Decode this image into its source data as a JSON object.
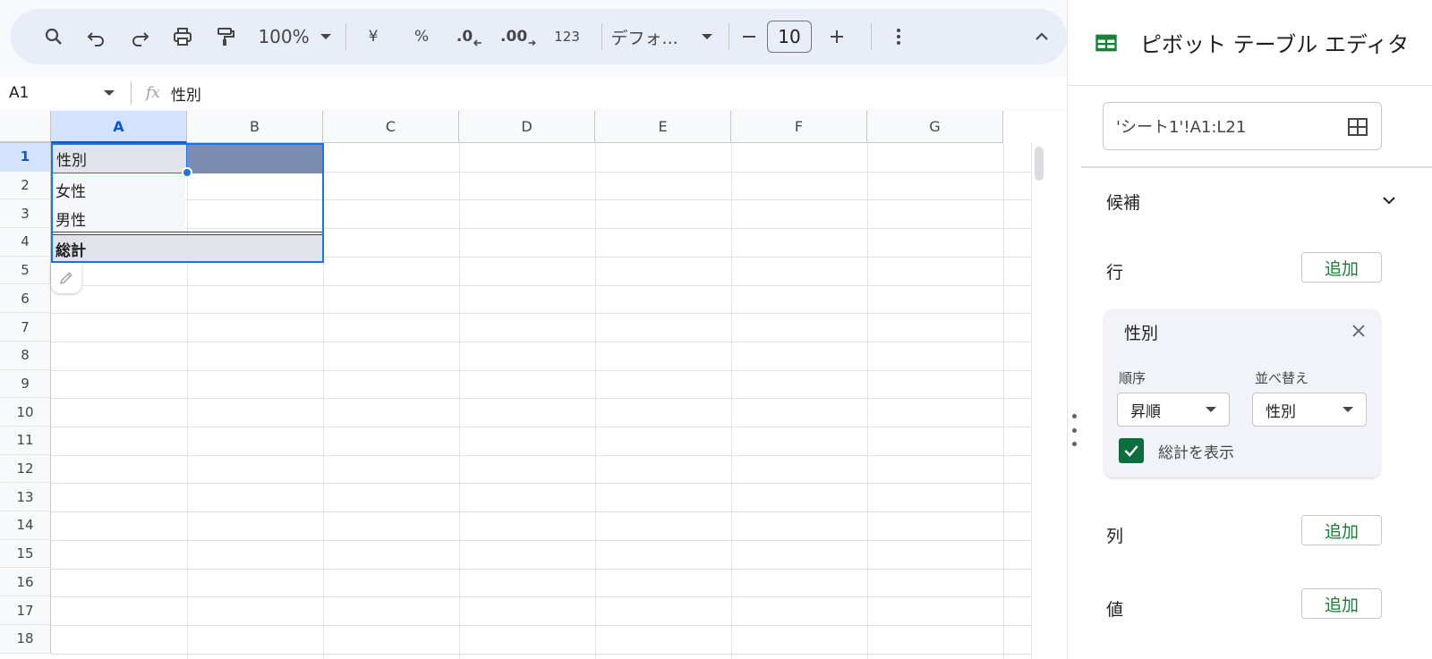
{
  "toolbar": {
    "zoom": "100%",
    "currency": "¥",
    "percent": "%",
    "decimal_decrease": ".0",
    "decimal_increase": ".00",
    "number_format": "123",
    "font": "デフォ...",
    "font_size": "10",
    "icons": [
      "search-icon",
      "undo-icon",
      "redo-icon",
      "print-icon",
      "paint-format-icon",
      "more-vert-icon",
      "chevron-up-icon"
    ]
  },
  "formula": {
    "cell_ref": "A1",
    "fx": "fx",
    "value": "性別"
  },
  "grid": {
    "columns": [
      "A",
      "B",
      "C",
      "D",
      "E",
      "F",
      "G"
    ],
    "rows": [
      "1",
      "2",
      "3",
      "4",
      "5",
      "6",
      "7",
      "8",
      "9",
      "10",
      "11",
      "12",
      "13",
      "14",
      "15",
      "16",
      "17",
      "18"
    ],
    "cells": {
      "A1": "性別",
      "A2": "女性",
      "A3": "男性",
      "A4": "総計"
    }
  },
  "panel": {
    "title": "ピボット テーブル エディタ",
    "range": "'シート1'!A1:L21",
    "suggestions_label": "候補",
    "rows_label": "行",
    "columns_label": "列",
    "values_label": "値",
    "add_label": "追加",
    "row_field": {
      "name": "性別",
      "order_label": "順序",
      "order_value": "昇順",
      "sort_by_label": "並べ替え",
      "sort_by_value": "性別",
      "show_totals_label": "総計を表示",
      "show_totals": true
    }
  },
  "colors": {
    "accent": "#1a73e8",
    "green": "#188038",
    "checkbox": "#0b6e3d",
    "pivot_header": "#7b8cb0"
  }
}
